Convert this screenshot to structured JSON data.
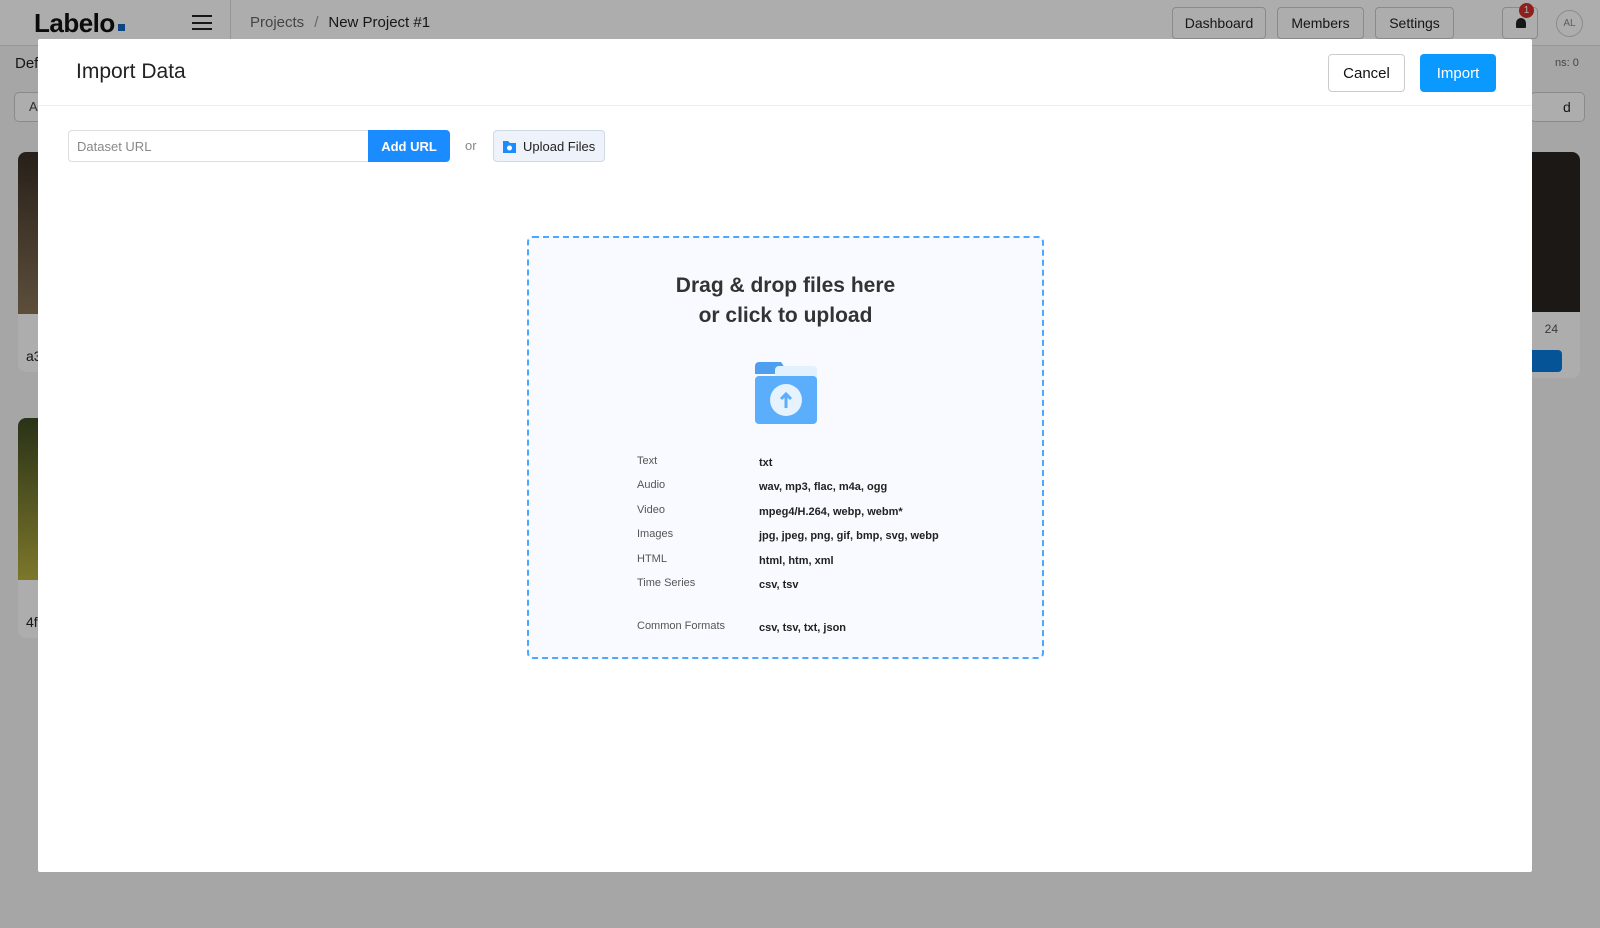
{
  "app": {
    "logo": "Labelo"
  },
  "breadcrumb": {
    "parent": "Projects",
    "separator": "/",
    "current": "New Project #1"
  },
  "nav": {
    "dashboard": "Dashboard",
    "members": "Members",
    "settings": "Settings",
    "notifications_count": "1",
    "avatar_initials": "AL"
  },
  "background": {
    "tab": "Def",
    "left_button": "A",
    "right_button": "d",
    "count_text": "ns: 0",
    "card_labels": [
      "a3",
      "4f"
    ],
    "right_card_text": "24"
  },
  "modal": {
    "title": "Import Data",
    "cancel": "Cancel",
    "import": "Import",
    "url_placeholder": "Dataset URL",
    "add_url": "Add URL",
    "or": "or",
    "upload_files": "Upload Files",
    "dropzone": {
      "line1": "Drag & drop files here",
      "line2": "or click to upload"
    },
    "formats": [
      {
        "type": "Text",
        "ext": "txt"
      },
      {
        "type": "Audio",
        "ext": "wav, mp3, flac, m4a, ogg"
      },
      {
        "type": "Video",
        "ext": "mpeg4/H.264, webp, webm*"
      },
      {
        "type": "Images",
        "ext": "jpg, jpeg, png, gif, bmp, svg, webp"
      },
      {
        "type": "HTML",
        "ext": "html, htm, xml"
      },
      {
        "type": "Time Series",
        "ext": "csv, tsv"
      },
      {
        "type": "Common Formats",
        "ext": "csv, tsv, txt, json"
      }
    ]
  },
  "colors": {
    "primary": "#0a99ff",
    "dropzone_border": "#4aa8ff",
    "folder": "#5aaefc",
    "badge": "#d32f2f"
  }
}
